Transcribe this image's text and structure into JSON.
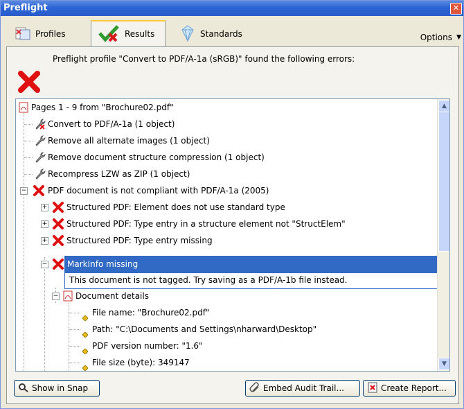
{
  "window": {
    "title": "Preflight",
    "close": "✕"
  },
  "tabs": [
    {
      "label": "Profiles",
      "icon": "profiles-icon"
    },
    {
      "label": "Results",
      "icon": "results-check-icon",
      "active": true
    },
    {
      "label": "Standards",
      "icon": "diamond-icon"
    }
  ],
  "options": {
    "label": "Options"
  },
  "message": "Preflight profile \"Convert to PDF/A-1a (sRGB)\" found the following errors:",
  "tree": {
    "root": "Pages 1 - 9 from \"Brochure02.pdf\"",
    "fixups": [
      "Convert to PDF/A-1a (1 object)",
      "Remove all alternate images (1 object)",
      "Remove document structure compression (1 object)",
      "Recompress LZW as ZIP (1 object)"
    ],
    "error_group": "PDF document is not compliant with PDF/A-1a (2005)",
    "errors": [
      "Structured PDF: Element does not use standard type",
      "Structured PDF: Type entry in a structure element not \"StructElem\"",
      "Structured PDF: Type entry missing"
    ],
    "selected": "MarkInfo missing",
    "tooltip": "This document is not tagged. Try saving as a PDF/A-1b file instead.",
    "details_label": "Document details",
    "details": [
      "File name: \"Brochure02.pdf\"",
      "Path: \"C:\\Documents and Settings\\nharward\\Desktop\"",
      "PDF version number: \"1.6\"",
      "File size (byte): 349147"
    ]
  },
  "buttons": {
    "show_in_snap": "Show in Snap",
    "embed_audit": "Embed Audit Trail...",
    "create_report": "Create Report..."
  },
  "colors": {
    "selection": "#316ac5",
    "error": "#e01010",
    "titlebar": "#2c64d6"
  }
}
